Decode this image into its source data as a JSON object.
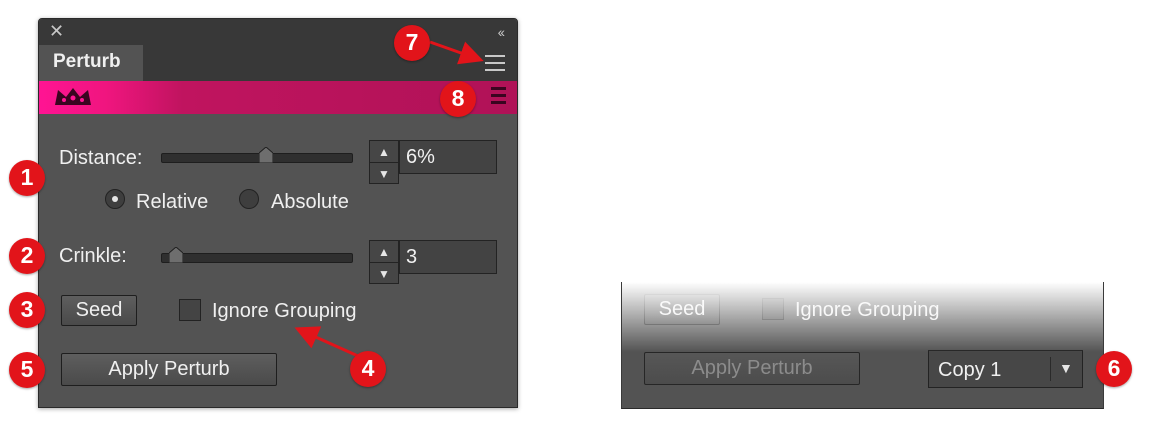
{
  "panel": {
    "close_glyph": "✕",
    "collapse_glyph": "‹‹",
    "tab_title": "Perturb",
    "distance": {
      "label": "Distance:",
      "value": "6%",
      "slider_fraction": 0.55
    },
    "mode": {
      "options": [
        "Relative",
        "Absolute"
      ],
      "selected": "Relative"
    },
    "crinkle": {
      "label": "Crinkle:",
      "value": "3",
      "slider_fraction": 0.08
    },
    "seed_label": "Seed",
    "ignore_grouping_label": "Ignore Grouping",
    "ignore_grouping_checked": false,
    "apply_label": "Apply Perturb"
  },
  "panel2": {
    "seed_label": "Seed",
    "ignore_grouping_label": "Ignore Grouping",
    "apply_label": "Apply Perturb",
    "apply_enabled": false,
    "copy_select_value": "Copy 1"
  },
  "callouts": [
    "1",
    "2",
    "3",
    "4",
    "5",
    "6",
    "7",
    "8"
  ],
  "colors": {
    "badge": "#e2141a",
    "banner_pink": "#ff1493",
    "banner_dark": "#b01257",
    "panel_bg": "#535353"
  },
  "icons": [
    "close-icon",
    "collapse-icon",
    "hamburger-menu-icon",
    "crown-icon",
    "banner-menu-icon",
    "arrow-up-icon",
    "arrow-down-icon",
    "dropdown-arrow-icon"
  ]
}
